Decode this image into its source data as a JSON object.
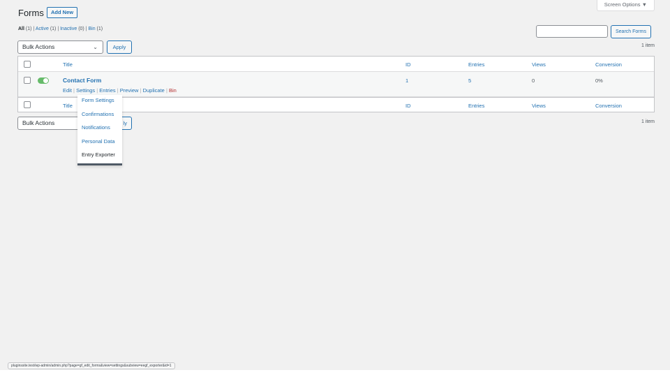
{
  "page": {
    "title": "Forms",
    "add_new_label": "Add New",
    "screen_options_label": "Screen Options ▼"
  },
  "views": [
    {
      "label": "All",
      "count": "(1)"
    },
    {
      "label": "Active",
      "count": "(1)"
    },
    {
      "label": "Inactive",
      "count": "(0)"
    },
    {
      "label": "Bin",
      "count": "(1)"
    }
  ],
  "search": {
    "placeholder": "",
    "button_label": "Search Forms"
  },
  "bulk": {
    "select_label": "Bulk Actions",
    "apply_label": "Apply",
    "apply_label_partial": "ly",
    "items_count": "1 item"
  },
  "table": {
    "columns": [
      "Title",
      "ID",
      "Entries",
      "Views",
      "Conversion"
    ],
    "rows": [
      {
        "title": "Contact Form",
        "id": "1",
        "entries": "5",
        "views": "0",
        "conversion": "0%",
        "active": true,
        "actions": [
          "Edit",
          "Settings",
          "Entries",
          "Preview",
          "Duplicate",
          "Bin"
        ]
      }
    ]
  },
  "settings_submenu": [
    "Form Settings",
    "Confirmations",
    "Notifications",
    "Personal Data",
    "Entry Exporter"
  ],
  "status_bar_url": "pluginssite.test/wp-admin/admin.php?page=gf_edit_forms&view=settings&subview=eegf_exporter&id=1",
  "colors": {
    "link": "#2271b1",
    "toggle_active": "#66bb6a",
    "trash": "#b32d2e"
  }
}
